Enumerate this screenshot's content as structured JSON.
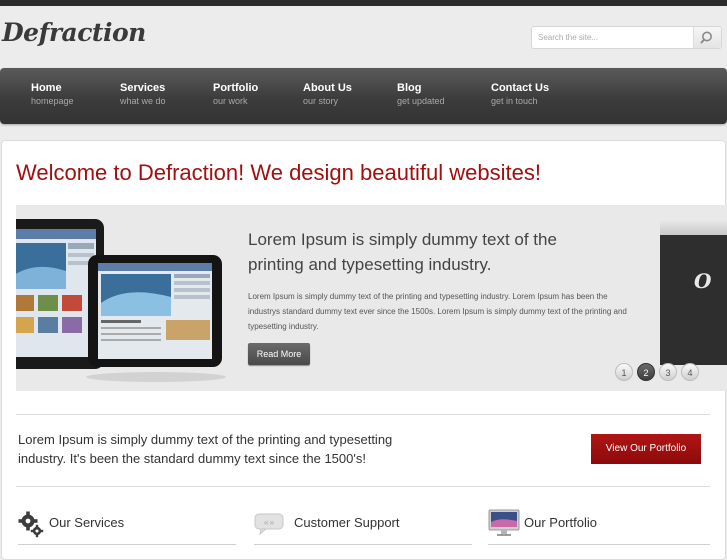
{
  "header": {
    "logo": "Defraction",
    "search_placeholder": "Search the site..."
  },
  "nav": {
    "items": [
      {
        "label": "Home",
        "sub": "homepage"
      },
      {
        "label": "Services",
        "sub": "what we do"
      },
      {
        "label": "Portfolio",
        "sub": "our work"
      },
      {
        "label": "About Us",
        "sub": "our story"
      },
      {
        "label": "Blog",
        "sub": "get updated"
      },
      {
        "label": "Contact Us",
        "sub": "get in touch"
      }
    ]
  },
  "main": {
    "welcome": "Welcome to Defraction! We design beautiful websites!",
    "slider": {
      "title": "Lorem Ipsum is simply dummy text of the printing and typesetting industry.",
      "text": "Lorem Ipsum is simply dummy text of the printing and typesetting industry. Lorem Ipsum has been the industrys standard dummy text ever since the 1500s. Lorem Ipsum is simply dummy text of the printing and typesetting industry.",
      "button": "Read More",
      "pages": [
        "1",
        "2",
        "3",
        "4"
      ],
      "active_page": 2,
      "peek_letter": "O"
    },
    "intro": "Lorem Ipsum is simply dummy text of the printing and typesetting industry. It's been the standard dummy text since the 1500's!",
    "portfolio_button": "View Our Portfolio",
    "columns": [
      {
        "title": "Our Services",
        "icon": "gears-icon"
      },
      {
        "title": "Customer Support",
        "icon": "speech-bubble-icon"
      },
      {
        "title": "Our Portfolio",
        "icon": "monitor-icon"
      }
    ]
  },
  "colors": {
    "accent": "#a10f0f",
    "nav_bg": "#3c3c3c",
    "page_bg": "#ececec"
  }
}
